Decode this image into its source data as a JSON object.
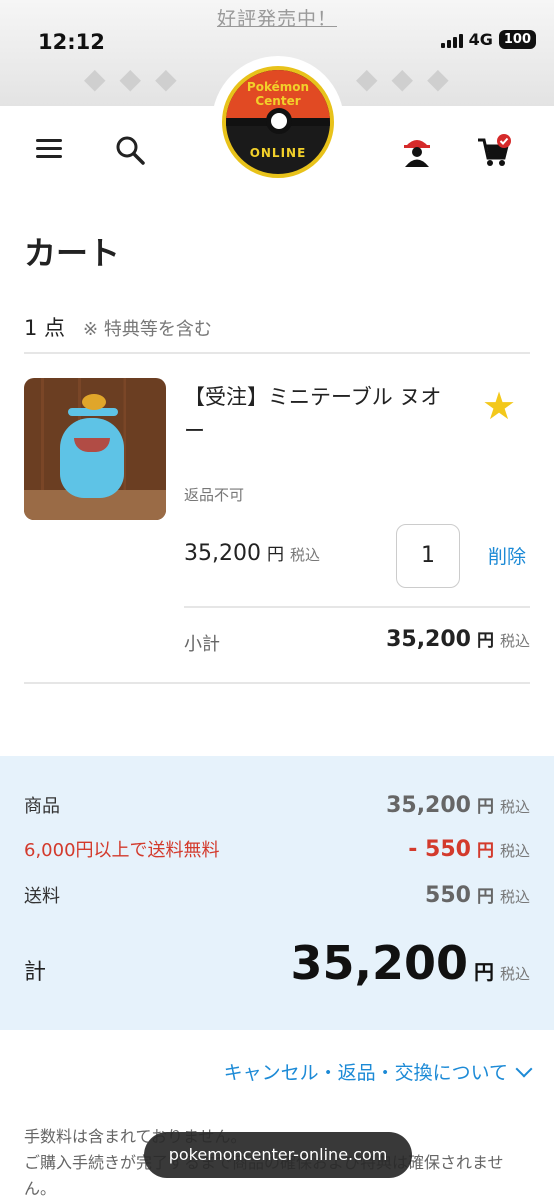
{
  "status_bar": {
    "time": "12:12",
    "network": "4G",
    "battery": "100"
  },
  "promo": "好評発売中！",
  "logo": {
    "line1": "Pokémon Center",
    "line2": "ONLINE"
  },
  "page": {
    "title": "カート"
  },
  "cart": {
    "count": "1 点",
    "count_note": "※ 特典等を含む",
    "item": {
      "name": "【受注】ミニテーブル ヌオー",
      "note": "返品不可",
      "price": "35,200",
      "yen": "円",
      "tax": "税込",
      "quantity": "1",
      "delete": "削除",
      "subtotal_label": "小計",
      "subtotal": "35,200"
    }
  },
  "summary": {
    "goods_label": "商品",
    "goods": "35,200",
    "discount_label": "6,000円以上で送料無料",
    "discount": "- 550",
    "shipping_label": "送料",
    "shipping": "550",
    "total_label": "計",
    "total": "35,200",
    "yen": "円",
    "tax": "税込"
  },
  "accordion": "キャンセル・返品・交換について",
  "footnote": {
    "line1": "手数料は含まれておりません。",
    "line2": "ご購入手続きが完了するまで商品の確保および特典は確保されません。"
  },
  "browser": {
    "url": "pokemoncenter-online.com"
  },
  "colors": {
    "accent_blue": "#1c8ad6",
    "discount_red": "#d33a2c",
    "summary_bg": "#e6f2fb"
  }
}
